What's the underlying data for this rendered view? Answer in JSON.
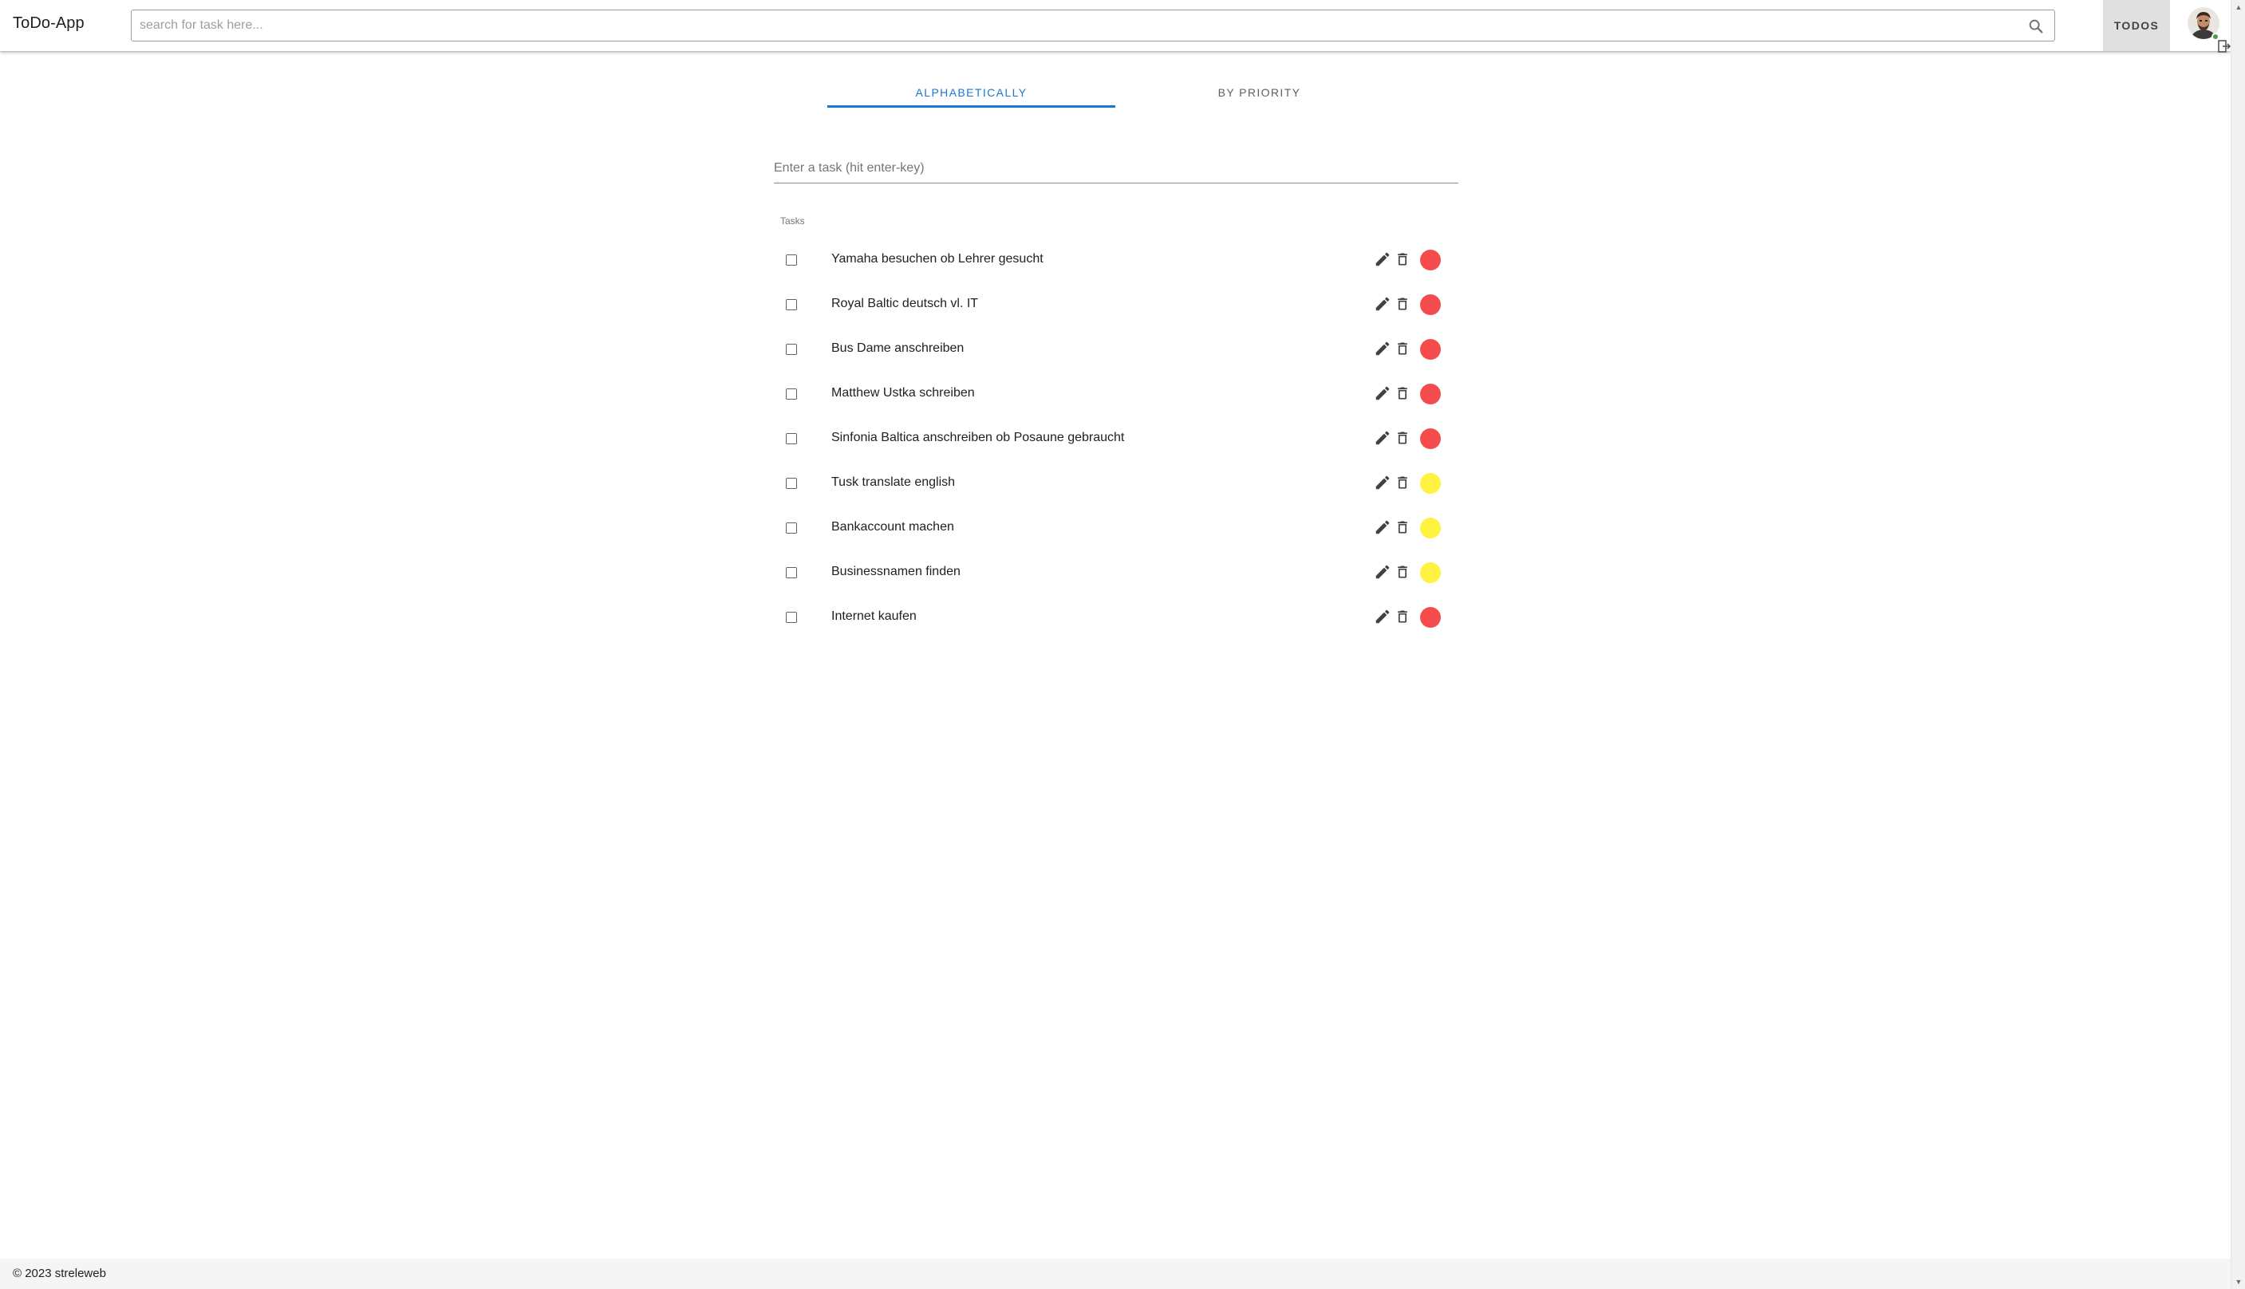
{
  "app": {
    "title": "ToDo-App"
  },
  "search": {
    "placeholder": "search for task here...",
    "value": "",
    "icon": "search-icon"
  },
  "nav": {
    "todos_label": "TODOS"
  },
  "user": {
    "avatar": "user-avatar",
    "status_color": "#43a047",
    "logout_icon": "logout-icon"
  },
  "tabs": [
    {
      "label": "ALPHABETICALLY",
      "active": true
    },
    {
      "label": "BY PRIORITY",
      "active": false
    }
  ],
  "task_input": {
    "placeholder": "Enter a task (hit enter-key)",
    "value": ""
  },
  "tasks_header": "Tasks",
  "priority_colors": {
    "high": "#f44c4c",
    "medium": "#fff240"
  },
  "accent_color": "#1976d2",
  "tasks": [
    {
      "text": "Yamaha besuchen ob Lehrer gesucht",
      "done": false,
      "priority": "high"
    },
    {
      "text": "Royal Baltic deutsch vl. IT",
      "done": false,
      "priority": "high"
    },
    {
      "text": "Bus Dame anschreiben",
      "done": false,
      "priority": "high"
    },
    {
      "text": "Matthew Ustka schreiben",
      "done": false,
      "priority": "high"
    },
    {
      "text": "Sinfonia Baltica anschreiben ob Posaune gebraucht",
      "done": false,
      "priority": "high"
    },
    {
      "text": "Tusk translate english",
      "done": false,
      "priority": "medium"
    },
    {
      "text": "Bankaccount machen",
      "done": false,
      "priority": "medium"
    },
    {
      "text": "Businessnamen finden",
      "done": false,
      "priority": "medium"
    },
    {
      "text": "Internet kaufen",
      "done": false,
      "priority": "high"
    }
  ],
  "footer": {
    "text": "© 2023 streleweb"
  }
}
